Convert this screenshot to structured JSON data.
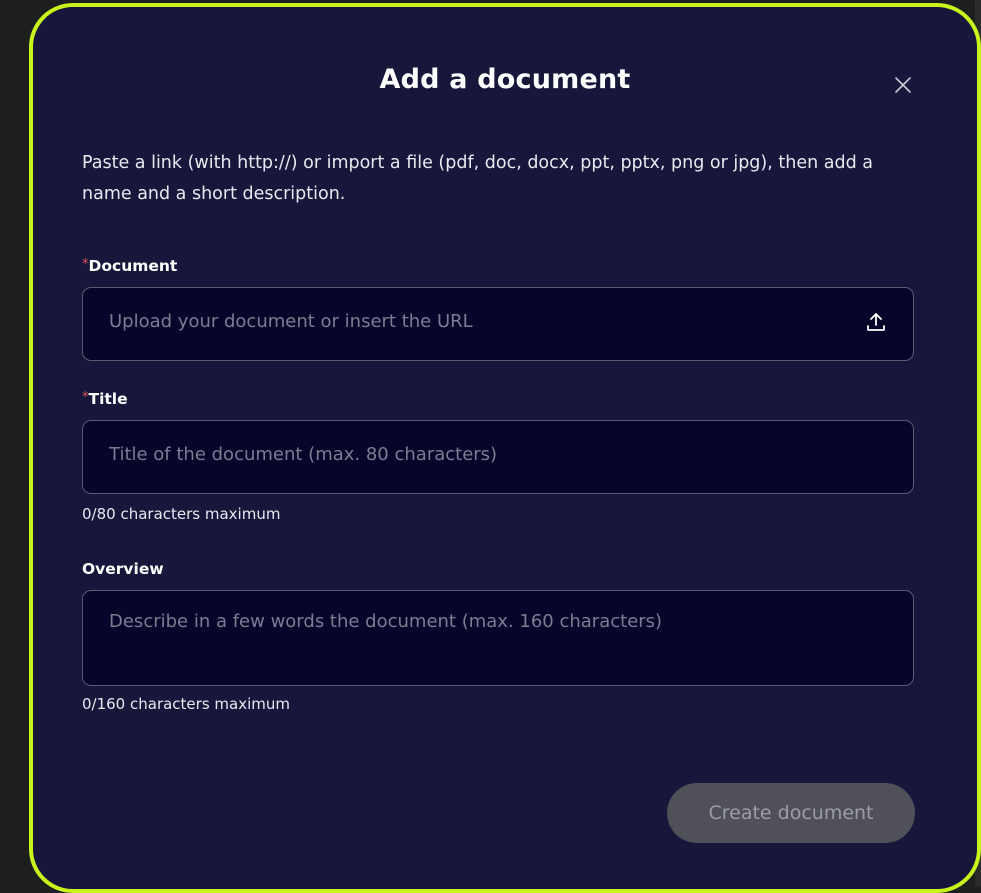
{
  "modal": {
    "title": "Add a document",
    "description": "Paste a link (with http://) or import a file (pdf, doc, docx, ppt, pptx, png or jpg), then add a name and a short description."
  },
  "document_field": {
    "required_mark": "*",
    "label": "Document",
    "placeholder": "Upload your document or insert the URL",
    "icon": "upload-icon"
  },
  "title_field": {
    "required_mark": "*",
    "label": "Title",
    "placeholder": "Title of the document (max. 80 characters)",
    "counter": "0/80 characters maximum"
  },
  "overview_field": {
    "label": "Overview",
    "placeholder": "Describe in a few words the document (max. 160 characters)",
    "counter": "0/160 characters maximum"
  },
  "actions": {
    "create_label": "Create document",
    "close_icon": "close-icon"
  },
  "colors": {
    "accent_border": "#c8f31b",
    "modal_bg": "#16173a",
    "input_bg": "#05062a",
    "required": "#e0525b",
    "disabled_button": "#4f5058"
  }
}
